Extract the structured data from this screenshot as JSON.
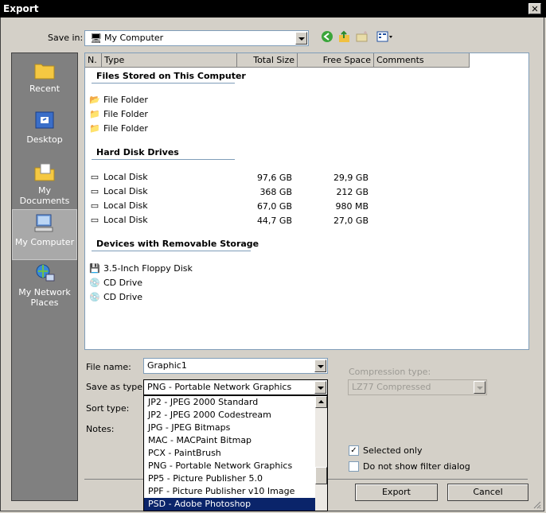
{
  "window": {
    "title": "Export",
    "close_glyph": "✕"
  },
  "save_in": {
    "label": "Save in:",
    "value": "My Computer",
    "toolbar_icons": [
      "back-arrow-icon",
      "up-folder-icon",
      "new-folder-icon",
      "view-menu-icon"
    ]
  },
  "places": [
    {
      "label": "Recent",
      "icon": "recent-folder-icon"
    },
    {
      "label": "Desktop",
      "icon": "desktop-icon"
    },
    {
      "label": "My Documents",
      "icon": "my-documents-icon"
    },
    {
      "label": "My Computer",
      "icon": "my-computer-icon",
      "selected": true
    },
    {
      "label": "My Network Places",
      "icon": "network-places-icon"
    }
  ],
  "columns": [
    "N.",
    "Type",
    "Total Size",
    "Free Space",
    "Comments"
  ],
  "groups": {
    "stored": "Files Stored on This Computer",
    "hdd": "Hard Disk Drives",
    "removable": "Devices with Removable Storage"
  },
  "stored_items": [
    "File Folder",
    "File Folder",
    "File Folder"
  ],
  "disks": [
    {
      "name": "Local Disk",
      "total": "97,6 GB",
      "free": "29,9 GB"
    },
    {
      "name": "Local Disk",
      "total": "368 GB",
      "free": "212 GB"
    },
    {
      "name": "Local Disk",
      "total": "67,0 GB",
      "free": "980 MB"
    },
    {
      "name": "Local Disk",
      "total": "44,7 GB",
      "free": "27,0 GB"
    }
  ],
  "removable_items": [
    "3.5-Inch Floppy Disk",
    "CD Drive",
    "CD Drive"
  ],
  "form": {
    "file_name_label": "File name:",
    "file_name_value": "Graphic1",
    "save_type_label": "Save as type:",
    "save_type_value": "PNG - Portable Network Graphics",
    "sort_label": "Sort type:",
    "notes_label": "Notes:",
    "compression_label": "Compression type:",
    "compression_value": "LZ77 Compressed"
  },
  "type_options": [
    "JP2 - JPEG 2000 Standard",
    "JP2 - JPEG 2000 Codestream",
    "JPG - JPEG Bitmaps",
    "MAC - MACPaint Bitmap",
    "PCX - PaintBrush",
    "PNG - Portable Network Graphics",
    "PP5 - Picture Publisher 5.0",
    "PPF - Picture Publisher v10 Image",
    "PSD - Adobe Photoshop"
  ],
  "type_selected_index": 8,
  "checks": {
    "selected_only": "Selected only",
    "selected_only_checked": true,
    "no_filter": "Do not show filter dialog",
    "no_filter_checked": false
  },
  "buttons": {
    "export": "Export",
    "cancel": "Cancel"
  },
  "colors": {
    "selection": "#0a246a",
    "dialog_bg": "#d4d0c8",
    "places_bg": "#808080"
  }
}
